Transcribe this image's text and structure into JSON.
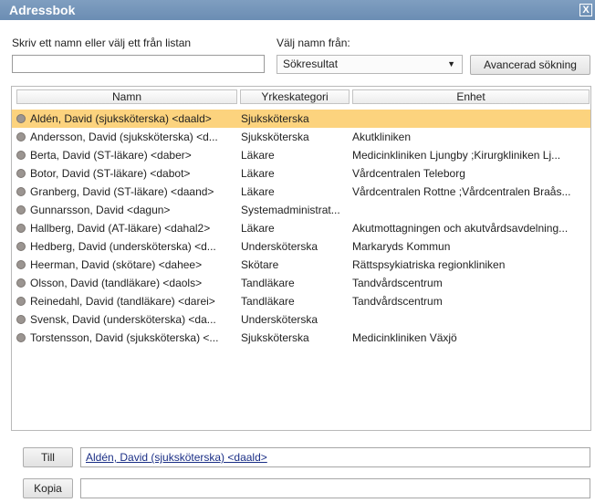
{
  "window": {
    "title": "Adressbok",
    "close_glyph": "X"
  },
  "search": {
    "label": "Skriv ett namn eller välj ett från listan",
    "value": "",
    "source_label": "Välj namn från:",
    "source_value": "Sökresultat",
    "advanced_button": "Avancerad sökning"
  },
  "list": {
    "columns": [
      "Namn",
      "Yrkeskategori",
      "Enhet"
    ],
    "rows": [
      {
        "name": "Aldén, David (sjuksköterska) <daald>",
        "category": "Sjuksköterska",
        "unit": "",
        "selected": true
      },
      {
        "name": "Andersson, David (sjuksköterska) <d...",
        "category": "Sjuksköterska",
        "unit": "Akutkliniken"
      },
      {
        "name": "Berta, David (ST-läkare) <daber>",
        "category": "Läkare",
        "unit": "Medicinkliniken Ljungby ;Kirurgkliniken Lj..."
      },
      {
        "name": "Botor, David (ST-läkare) <dabot>",
        "category": "Läkare",
        "unit": "Vårdcentralen Teleborg"
      },
      {
        "name": "Granberg, David (ST-läkare) <daand>",
        "category": "Läkare",
        "unit": "Vårdcentralen Rottne ;Vårdcentralen Braås..."
      },
      {
        "name": "Gunnarsson, David <dagun>",
        "category": "Systemadministrat...",
        "unit": ""
      },
      {
        "name": "Hallberg, David (AT-läkare) <dahal2>",
        "category": "Läkare",
        "unit": "Akutmottagningen och akutvårdsavdelning..."
      },
      {
        "name": "Hedberg, David (undersköterska) <d...",
        "category": "Undersköterska",
        "unit": "Markaryds Kommun"
      },
      {
        "name": "Heerman, David (skötare) <dahee>",
        "category": "Skötare",
        "unit": "Rättspsykiatriska regionkliniken"
      },
      {
        "name": "Olsson, David (tandläkare) <daols>",
        "category": "Tandläkare",
        "unit": "Tandvårdscentrum"
      },
      {
        "name": "Reinedahl, David (tandläkare) <darei>",
        "category": "Tandläkare",
        "unit": "Tandvårdscentrum"
      },
      {
        "name": "Svensk, David (undersköterska) <da...",
        "category": "Undersköterska",
        "unit": ""
      },
      {
        "name": "Torstensson, David (sjuksköterska) <...",
        "category": "Sjuksköterska",
        "unit": "Medicinkliniken Växjö"
      }
    ]
  },
  "recipients": {
    "to_button": "Till",
    "to_value": "Aldén, David (sjuksköterska) <daald>",
    "cc_button": "Kopia",
    "cc_value": ""
  },
  "colors": {
    "titlebar": "#7396ba",
    "selected_row": "#fcd37e",
    "recipient_link": "#1b2f86"
  }
}
